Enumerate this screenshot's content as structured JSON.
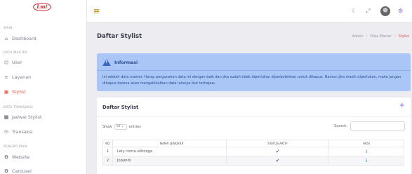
{
  "brand": {
    "logo_text": "Lmt"
  },
  "sidebar": {
    "sections": [
      {
        "label": "MAIN"
      },
      {
        "label": "DATA MASTER"
      },
      {
        "label": "DATA TRANSAKSI"
      },
      {
        "label": "PENGATURAN"
      }
    ],
    "items": [
      {
        "label": "Dashboard",
        "icon": "home-icon"
      },
      {
        "label": "User",
        "icon": "users-icon"
      },
      {
        "label": "Layanan",
        "icon": "list-icon"
      },
      {
        "label": "Stylist",
        "icon": "briefcase-icon",
        "active": true
      },
      {
        "label": "Jadwal Stylist",
        "icon": "calendar-icon"
      },
      {
        "label": "Transaksi",
        "icon": "mail-icon"
      },
      {
        "label": "Website",
        "icon": "gears-icon"
      },
      {
        "label": "Carousel",
        "icon": "gears-icon"
      }
    ]
  },
  "topbar": {
    "icons": [
      "menu-icon",
      "moon-icon",
      "expand-icon",
      "avatar",
      "settings-icon"
    ]
  },
  "page": {
    "title": "Daftar Stylist",
    "breadcrumb": [
      "Admin",
      "Data Master",
      "Stylist"
    ]
  },
  "alert": {
    "title": "Informasi",
    "text": "Ini adalah data master. Harap pergunakan data ini dengan baik dan jika sudah tidak diperlukan diperbolehkan untuk dihapus. Namun jika masih diperlukan, maka jangan dihapus karena akan mengakibatkan data lainnya ikut terhapus."
  },
  "card": {
    "title": "Daftar Stylist",
    "add_icon": "+",
    "show_label": "Show",
    "show_value": "10",
    "entries_label": "entries",
    "search_label": "Search:"
  },
  "table": {
    "headers": [
      "NO",
      "NAMA LENGKAP",
      "STATUS AKTIF",
      "AKSI"
    ],
    "rows": [
      {
        "no": "1",
        "name": "Lely risma silitonga",
        "status": "✔",
        "action": "i"
      },
      {
        "no": "2",
        "name": "Jopandi",
        "status": "✔",
        "action": "i"
      }
    ]
  },
  "colors": {
    "accent": "#e95a4b",
    "alert_bg": "#a9c6f6",
    "alert_text": "#2c4f94",
    "purple": "#7c5ad8",
    "logo_red": "#d7262e"
  }
}
